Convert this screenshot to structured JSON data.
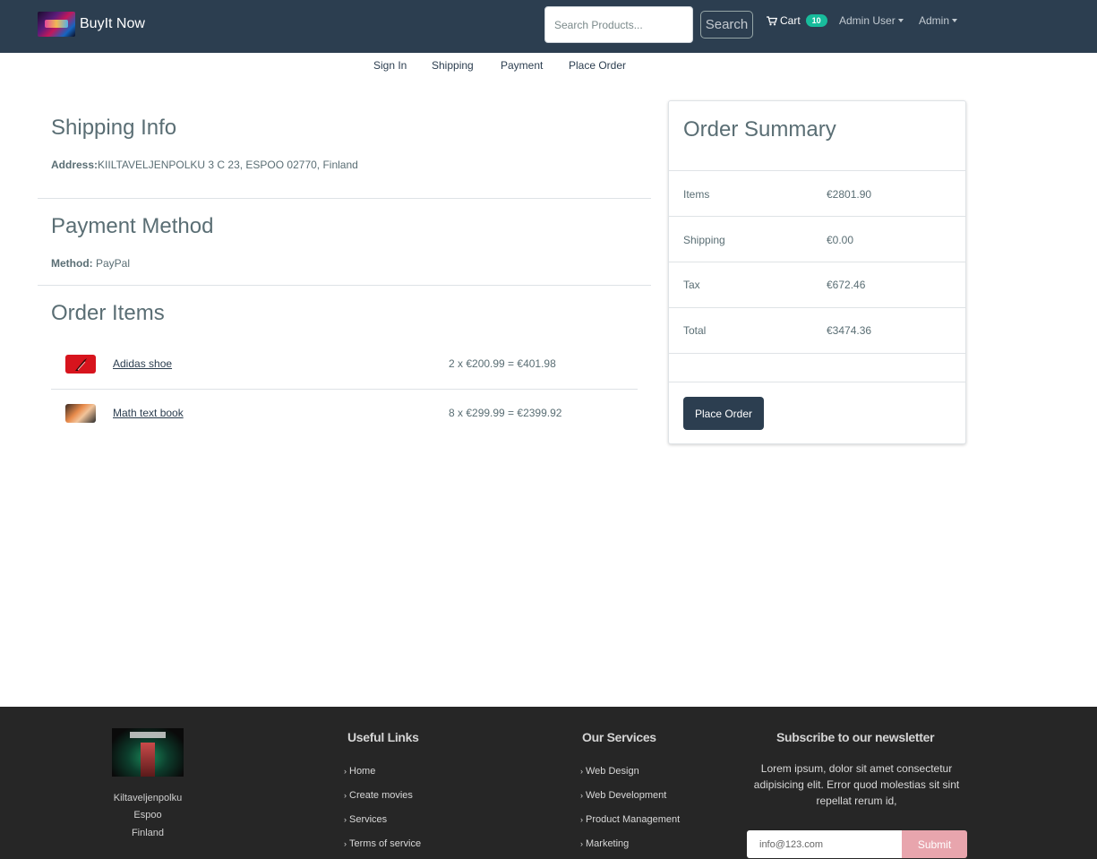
{
  "navbar": {
    "brand": "BuyIt Now",
    "search_placeholder": "Search Products...",
    "search_button": "Search",
    "cart_label": "Cart",
    "cart_count": "10",
    "user_menu": "Admin User",
    "admin_menu": "Admin"
  },
  "steps": [
    "Sign In",
    "Shipping",
    "Payment",
    "Place Order"
  ],
  "shipping": {
    "title": "Shipping Info",
    "address_label": "Address:",
    "address": "KIILTAVELJENPOLKU 3 C 23, ESPOO 02770, Finland"
  },
  "payment": {
    "title": "Payment Method",
    "method_label": "Method:",
    "method": "PayPal"
  },
  "order_items": {
    "title": "Order Items",
    "items": [
      {
        "name": "Adidas shoe",
        "calc": "2 x €200.99 = €401.98",
        "image": "red-shoe-image"
      },
      {
        "name": "Math text book",
        "calc": "8 x €299.99 = €2399.92",
        "image": "book-image"
      }
    ]
  },
  "summary": {
    "title": "Order Summary",
    "rows": [
      {
        "label": "Items",
        "value": "€2801.90"
      },
      {
        "label": "Shipping",
        "value": "€0.00"
      },
      {
        "label": "Tax",
        "value": "€672.46"
      },
      {
        "label": "Total",
        "value": "€3474.36"
      }
    ],
    "button": "Place Order"
  },
  "footer": {
    "address_lines": [
      "Kiltaveljenpolku",
      "Espoo",
      "Finland"
    ],
    "useful_links_title": "Useful Links",
    "useful_links": [
      "Home",
      "Create movies",
      "Services",
      "Terms of service"
    ],
    "services_title": "Our Services",
    "services": [
      "Web Design",
      "Web Development",
      "Product Management",
      "Marketing"
    ],
    "newsletter_title": "Subscribe to our newsletter",
    "newsletter_text": "Lorem ipsum, dolor sit amet consectetur adipisicing elit. Error quod molestias sit sint repellat rerum id,",
    "newsletter_placeholder": "info@123.com",
    "newsletter_button": "Submit"
  },
  "colors": {
    "navbar": "#2c3e50",
    "badge": "#18bc9c",
    "footer": "#262626",
    "submit": "#e8a5ad"
  }
}
